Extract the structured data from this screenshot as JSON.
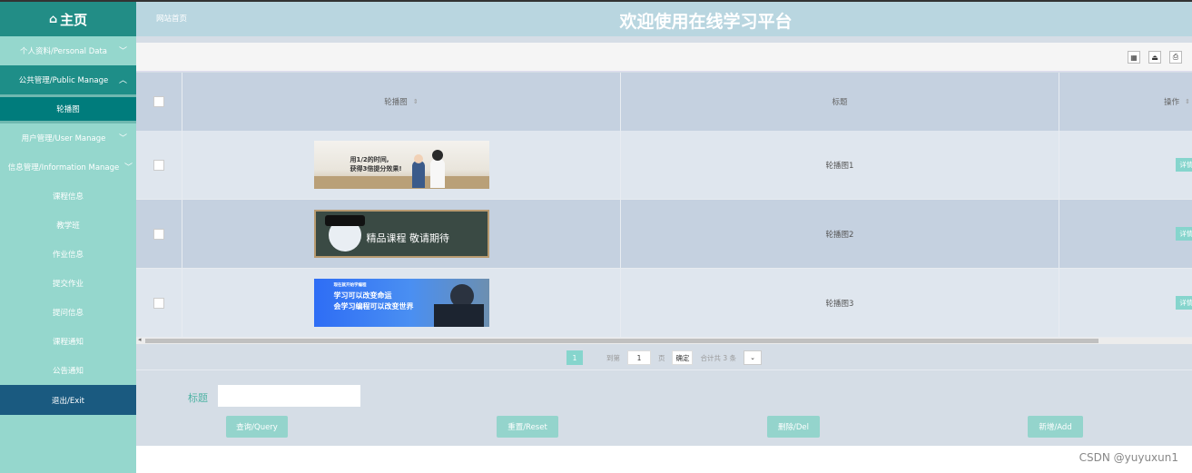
{
  "brand": {
    "label": "主页",
    "icon": "home-icon"
  },
  "sidebar": {
    "items": [
      {
        "label": "个人资料/Personal Data"
      },
      {
        "label": "公共管理/Public Manage"
      },
      {
        "label": "轮播图"
      },
      {
        "label": "用户管理/User Manage"
      },
      {
        "label": "信息管理/Information Manage"
      },
      {
        "label": "课程信息"
      },
      {
        "label": "教学班"
      },
      {
        "label": "作业信息"
      },
      {
        "label": "提交作业"
      },
      {
        "label": "提问信息"
      },
      {
        "label": "课程通知"
      },
      {
        "label": "公告通知"
      },
      {
        "label": "退出/Exit"
      }
    ]
  },
  "header": {
    "breadcrumb": "网站首页",
    "title": "欢迎使用在线学习平台"
  },
  "table": {
    "columns": [
      "轮播图",
      "标题",
      "操作"
    ],
    "rows": [
      {
        "title": "轮播图1",
        "action": "详情/Detail",
        "banner_text_1": "用1/2的时间,",
        "banner_text_2": "获得3倍提分效果!"
      },
      {
        "title": "轮播图2",
        "action": "详情/Detail",
        "banner_text": "精品课程 敬请期待"
      },
      {
        "title": "轮播图3",
        "action": "详情/Detail",
        "banner_text_0": "现在就开始学编程",
        "banner_text_1": "学习可以改变命运",
        "banner_text_2": "会学习编程可以改变世界"
      }
    ]
  },
  "pager": {
    "current_page": "1",
    "goto_label": "到第",
    "goto_value": "1",
    "page_unit": "页",
    "confirm": "确定",
    "total": "合计共 3 条"
  },
  "search": {
    "label": "标题",
    "placeholder": "",
    "buttons": [
      "查询/Query",
      "重置/Reset",
      "删除/Del",
      "新增/Add"
    ]
  },
  "watermark": "CSDN @yuyuxun1",
  "colors": {
    "sidebar": "#95d7cd",
    "accent": "#007c7c",
    "exit": "#1a5a80",
    "header": "#b9d6e0",
    "button": "#94d4cc"
  }
}
